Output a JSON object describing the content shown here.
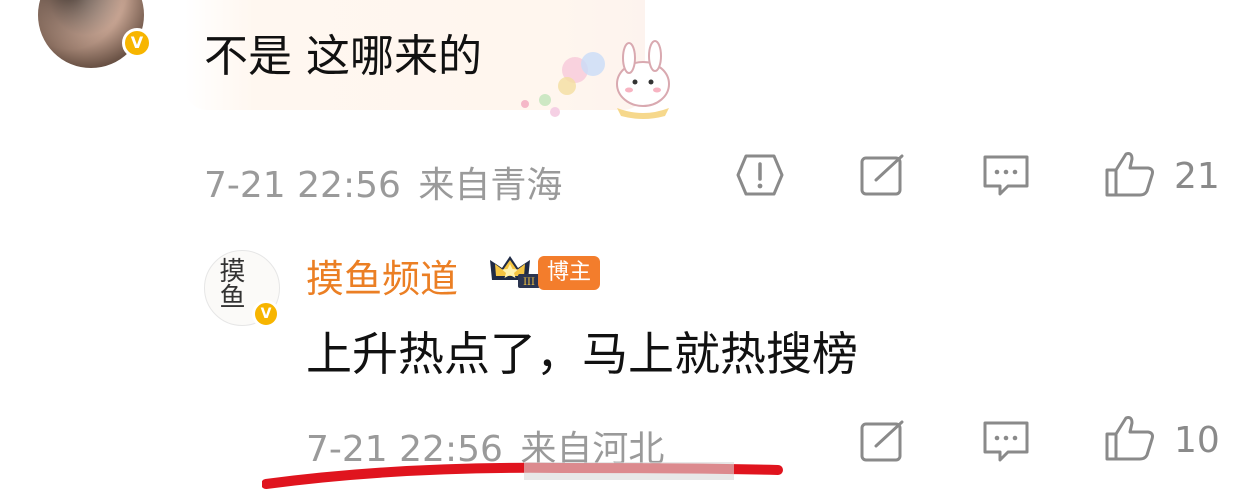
{
  "comment1": {
    "text": "不是 这哪来的",
    "timestamp": "7-21 22:56",
    "location": "来自青海",
    "like_count": "21",
    "avatar_badge": "V"
  },
  "reply": {
    "username": "摸鱼频道",
    "badge_label": "博主",
    "level_badge": "III",
    "avatar_logo": "摸鱼",
    "text": "上升热点了，马上就热搜榜",
    "timestamp": "7-21 22:56",
    "location": "来自河北",
    "like_count": "10",
    "avatar_badge": "V"
  },
  "colors": {
    "username": "#eb7f24",
    "verified": "#f7b500",
    "meta": "#9a9a9a",
    "annotation": "#e0141e"
  },
  "icons": [
    "report-icon",
    "repost-icon",
    "comment-icon",
    "like-icon"
  ]
}
